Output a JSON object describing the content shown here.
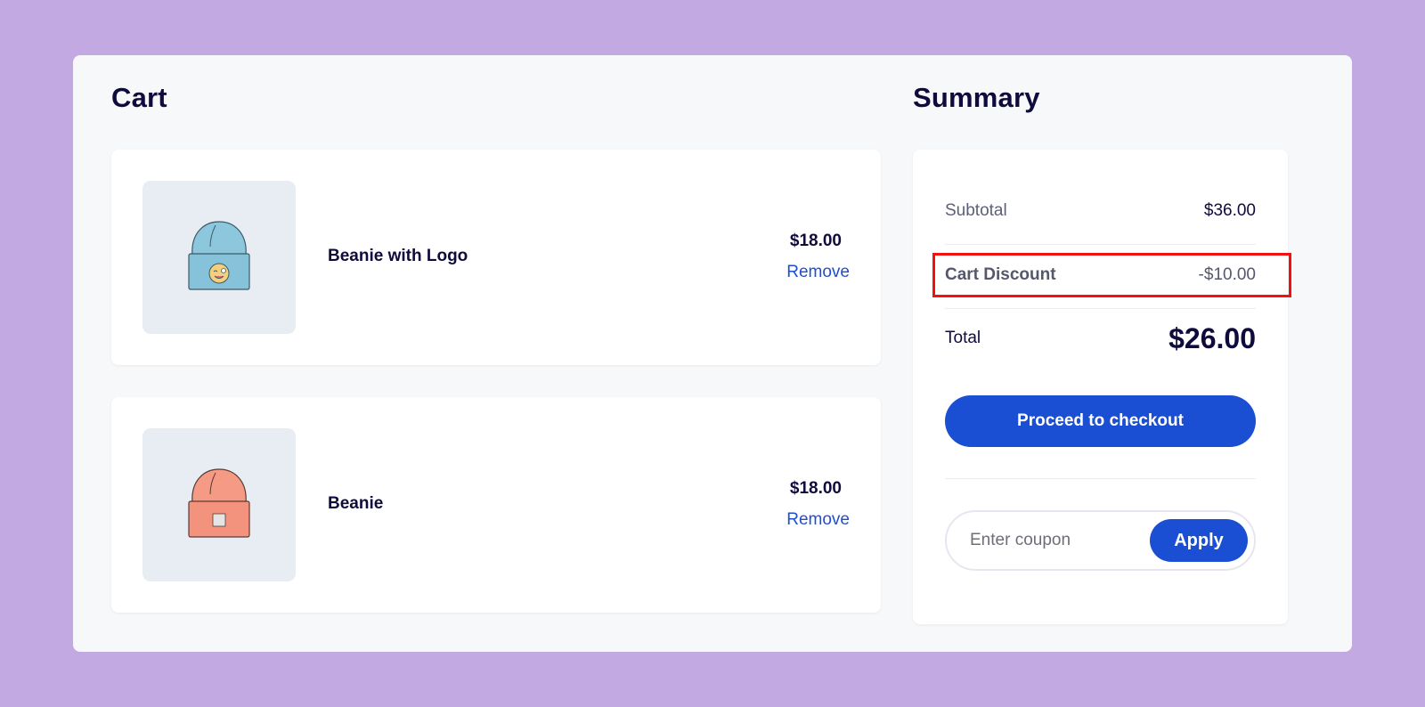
{
  "cart": {
    "title": "Cart",
    "items": [
      {
        "name": "Beanie with Logo",
        "price": "$18.00",
        "remove_label": "Remove",
        "image": "blue-beanie-with-logo",
        "color": "#8cc7dd"
      },
      {
        "name": "Beanie",
        "price": "$18.00",
        "remove_label": "Remove",
        "image": "orange-beanie",
        "color": "#f59a85"
      }
    ]
  },
  "summary": {
    "title": "Summary",
    "subtotal_label": "Subtotal",
    "subtotal_value": "$36.00",
    "discount_label": "Cart Discount",
    "discount_value": "-$10.00",
    "total_label": "Total",
    "total_value": "$26.00",
    "checkout_label": "Proceed to checkout",
    "coupon_placeholder": "Enter coupon",
    "apply_label": "Apply"
  },
  "colors": {
    "background": "#c3a9e2",
    "accent": "#1a4fd3",
    "highlight": "#f21010"
  }
}
